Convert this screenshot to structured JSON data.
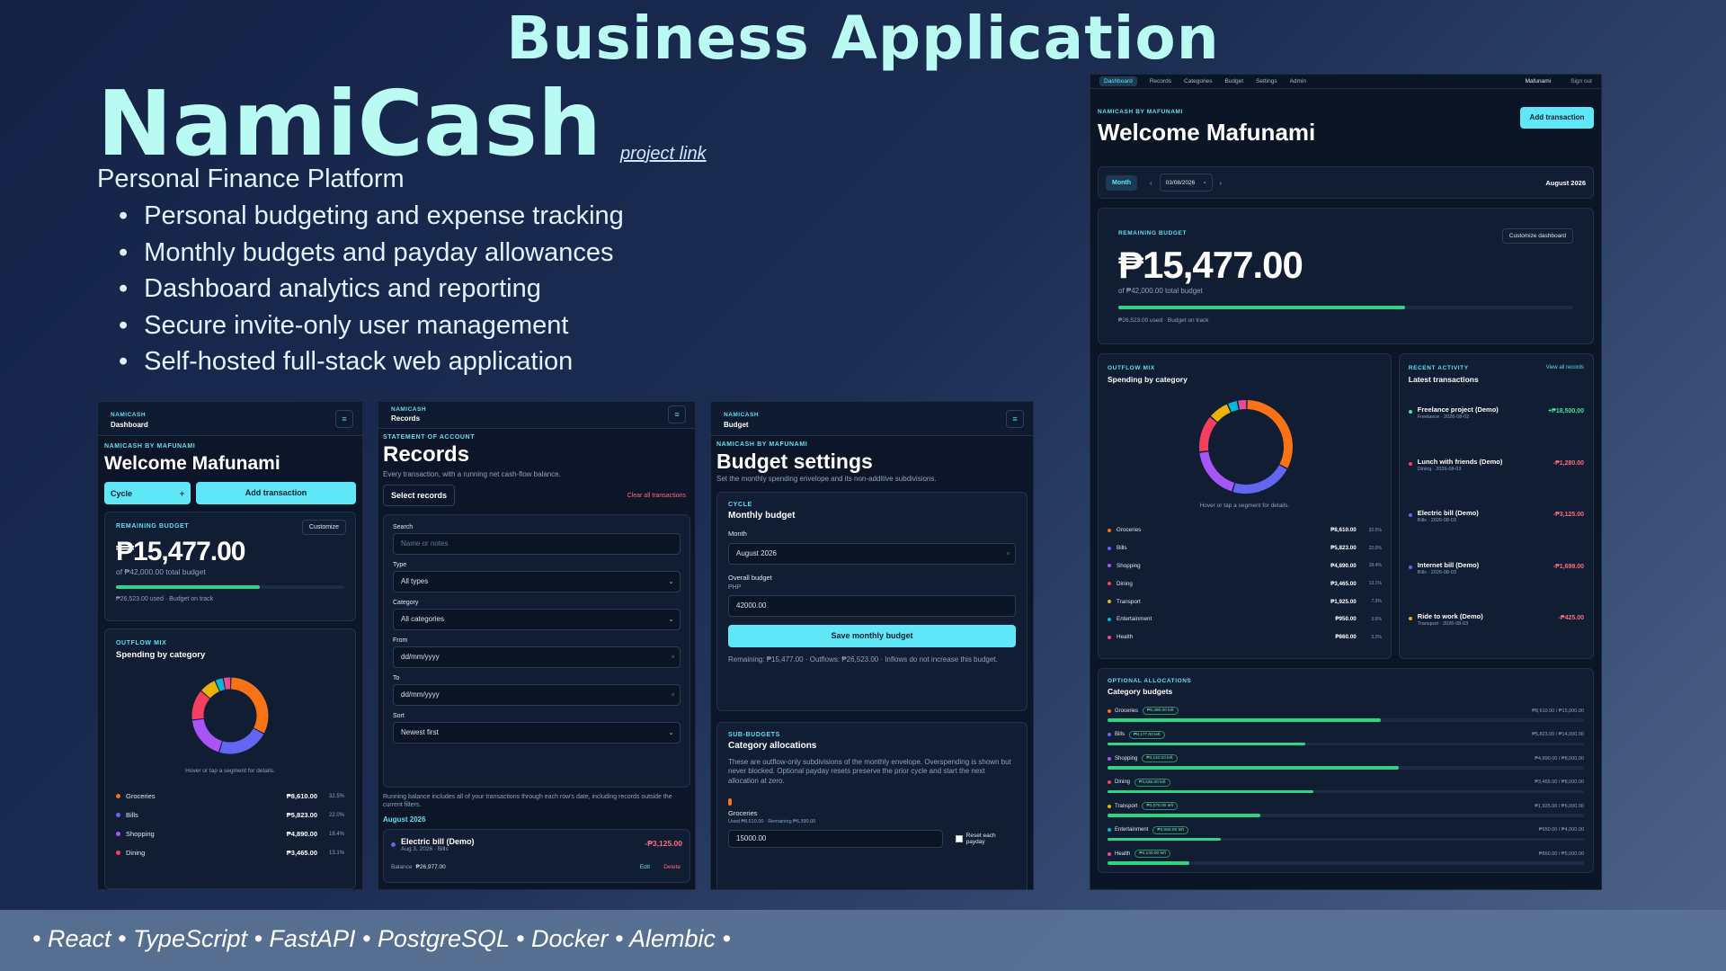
{
  "banner": {
    "title": "Business Application"
  },
  "hero": {
    "brand": "NamiCash",
    "project_link": "project link",
    "tagline": "Personal Finance Platform",
    "bullets": [
      "Personal budgeting and expense tracking",
      "Monthly budgets and payday allowances",
      "Dashboard analytics and reporting",
      "Secure invite-only user management",
      "Self-hosted full-stack web application"
    ]
  },
  "footer": {
    "tech": "• React • TypeScript • FastAPI • PostgreSQL • Docker • Alembic •"
  },
  "colors": {
    "accent": "#5fe6f7",
    "progress": "#30d483",
    "negative": "#ff6b7d",
    "positive": "#47e39a"
  },
  "categories": [
    {
      "name": "Groceries",
      "amount": "₱8,610.00",
      "pct": "32.5%",
      "color": "#f97316",
      "value": 8610,
      "left": "₱6,390.00 left",
      "progress": "₱8,610.00 / ₱15,000.00",
      "fill": 0.574
    },
    {
      "name": "Bills",
      "amount": "₱5,823.00",
      "pct": "22.0%",
      "color": "#6366f1",
      "value": 5823,
      "left": "₱8,177.00 left",
      "progress": "₱5,823.00 / ₱14,000.00",
      "fill": 0.416
    },
    {
      "name": "Shopping",
      "amount": "₱4,890.00",
      "pct": "18.4%",
      "color": "#a855f7",
      "value": 4890,
      "left": "₱3,110.00 left",
      "progress": "₱4,890.00 / ₱8,000.00",
      "fill": 0.611
    },
    {
      "name": "Dining",
      "amount": "₱3,465.00",
      "pct": "13.1%",
      "color": "#f43f5e",
      "value": 3465,
      "left": "₱4,535.00 left",
      "progress": "₱3,465.00 / ₱8,000.00",
      "fill": 0.433
    },
    {
      "name": "Transport",
      "amount": "₱1,925.00",
      "pct": "7.3%",
      "color": "#eab308",
      "value": 1925,
      "left": "₱4,075.00 left",
      "progress": "₱1,925.00 / ₱6,000.00",
      "fill": 0.321
    },
    {
      "name": "Entertainment",
      "amount": "₱950.00",
      "pct": "3.6%",
      "color": "#06b6d4",
      "value": 950,
      "left": "₱3,050.00 left",
      "progress": "₱950.00 / ₱4,000.00",
      "fill": 0.2375
    },
    {
      "name": "Health",
      "amount": "₱860.00",
      "pct": "3.2%",
      "color": "#ec4899",
      "value": 860,
      "left": "₱4,140.00 left",
      "progress": "₱860.00 / ₱5,000.00",
      "fill": 0.172
    }
  ],
  "screen1": {
    "nav_sub": "NAMICASH",
    "nav_title": "Dashboard",
    "menu_icon": "≡",
    "eyebrow": "NAMICASH BY MAFUNAMI",
    "welcome": "Welcome Mafunami",
    "cycle_label": "Cycle",
    "cycle_icon": "+",
    "add_label": "Add transaction",
    "remaining_label": "REMAINING BUDGET",
    "customize": "Customize",
    "amount": "₱15,477.00",
    "of_total": "of ₱42,000.00 total budget",
    "used_note": "₱26,523.00 used · Budget on track",
    "budget_fill": 0.631,
    "outflow_eyebrow": "OUTFLOW MIX",
    "spending_title": "Spending by category",
    "hint": "Hover or tap a segment for details.",
    "rows": [
      {
        "name": "Groceries",
        "amount": "₱8,610.00",
        "pct": "32.5%"
      },
      {
        "name": "Bills",
        "amount": "₱5,823.00",
        "pct": "22.0%"
      },
      {
        "name": "Shopping",
        "amount": "₱4,890.00",
        "pct": "18.4%"
      },
      {
        "name": "Dining",
        "amount": "₱3,465.00",
        "pct": "13.1%"
      }
    ]
  },
  "screen2": {
    "nav_sub": "NAMICASH",
    "nav_title": "Records",
    "menu_icon": "≡",
    "eyebrow": "STATEMENT OF ACCOUNT",
    "title": "Records",
    "subtitle": "Every transaction, with a running net cash-flow balance.",
    "select_btn": "Select records",
    "clear_link": "Clear all transactions",
    "search_label": "Search",
    "search_placeholder": "Name or notes",
    "type_label": "Type",
    "type_value": "All types",
    "category_label": "Category",
    "category_value": "All categories",
    "from_label": "From",
    "from_value": "dd/mm/yyyy",
    "to_label": "To",
    "to_value": "dd/mm/yyyy",
    "sort_label": "Sort",
    "sort_value": "Newest first",
    "note": "Running balance includes all of your transactions through each row's date, including records outside the current filters.",
    "month_header": "August 2026",
    "tx_name": "Electric bill (Demo)",
    "tx_meta": "Aug 3, 2026 · Bills",
    "tx_amount": "-₱3,125.00",
    "balance_label": "Balance",
    "balance_value": "₱26,977.00",
    "edit": "Edit",
    "delete": "Delete"
  },
  "screen3": {
    "nav_sub": "NAMICASH",
    "nav_title": "Budget",
    "menu_icon": "≡",
    "eyebrow": "NAMICASH BY MAFUNAMI",
    "title": "Budget settings",
    "subtitle": "Set the monthly spending envelope and its non-additive subdivisions.",
    "cycle_eyebrow": "CYCLE",
    "card_title": "Monthly budget",
    "month_label": "Month",
    "month_value": "August 2026",
    "overall_label": "Overall budget",
    "currency": "PHP",
    "overall_value": "42000.00",
    "save_btn": "Save monthly budget",
    "remaining_note": "Remaining: ₱15,477.00 · Outflows: ₱26,523.00 · Inflows do not increase this budget.",
    "sub_eyebrow": "SUB-BUDGETS",
    "alloc_title": "Category allocations",
    "alloc_note": "These are outflow-only subdivisions of the monthly envelope. Overspending is shown but never blocked. Optional payday resets preserve the prior cycle and start the next allocation at zero.",
    "cat_name": "Groceries",
    "cat_meta": "Used ₱8,610.00 · Remaining ₱6,390.00",
    "cat_value": "15000.00",
    "reset_label": "Reset each payday"
  },
  "desktop": {
    "nav": [
      "Dashboard",
      "Records",
      "Categories",
      "Budget",
      "Settings",
      "Admin"
    ],
    "user": "Mafunami",
    "signout": "Sign out",
    "eyebrow": "NAMICASH BY MAFUNAMI",
    "welcome": "Welcome Mafunami",
    "add_btn": "Add transaction",
    "period_btn": "Month",
    "prev": "‹",
    "date_value": "03/08/2026",
    "next": "›",
    "period_label": "August 2026",
    "remaining_label": "REMAINING BUDGET",
    "customize": "Customize dashboard",
    "amount": "₱15,477.00",
    "of_total": "of ₱42,000.00 total budget",
    "used_note": "₱26,523.00 used · Budget on track",
    "budget_fill": 0.631,
    "outflow_eyebrow": "OUTFLOW MIX",
    "spending_title": "Spending by category",
    "hint": "Hover or tap a segment for details.",
    "activity_eyebrow": "RECENT ACTIVITY",
    "activity_title": "Latest transactions",
    "view_all": "View all records",
    "transactions": [
      {
        "name": "Freelance project (Demo)",
        "meta": "Freelance · 2026-08-02",
        "amount": "+₱18,500.00",
        "color": "#47e39a",
        "positive": true
      },
      {
        "name": "Lunch with friends (Demo)",
        "meta": "Dining · 2026-08-03",
        "amount": "-₱1,280.00",
        "color": "#f43f5e",
        "positive": false
      },
      {
        "name": "Electric bill (Demo)",
        "meta": "Bills · 2026-08-03",
        "amount": "-₱3,125.00",
        "color": "#6366f1",
        "positive": false
      },
      {
        "name": "Internet bill (Demo)",
        "meta": "Bills · 2026-08-03",
        "amount": "-₱1,699.00",
        "color": "#6366f1",
        "positive": false
      },
      {
        "name": "Ride to work (Demo)",
        "meta": "Transport · 2026-08-03",
        "amount": "-₱425.00",
        "color": "#eab308",
        "positive": false
      }
    ],
    "alloc_eyebrow": "OPTIONAL ALLOCATIONS",
    "alloc_title": "Category budgets"
  }
}
